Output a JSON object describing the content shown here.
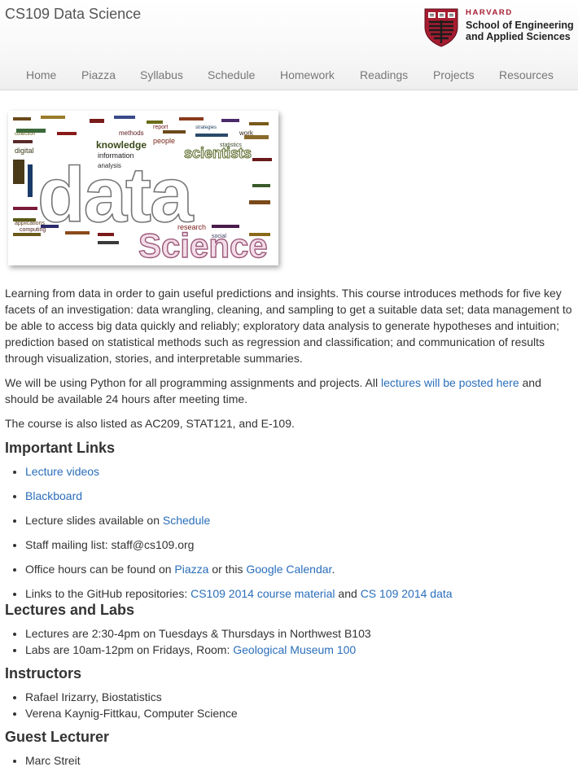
{
  "header": {
    "site_title": "CS109 Data Science",
    "logo": {
      "harvard": "HARVARD",
      "school_line1": "School of Engineering",
      "school_line2": "and Applied Sciences"
    },
    "nav": [
      "Home",
      "Piazza",
      "Syllabus",
      "Schedule",
      "Homework",
      "Readings",
      "Projects",
      "Resources"
    ]
  },
  "hero_image": {
    "title_word1": "data",
    "title_word2": "Science",
    "cloud_words": [
      "knowledge",
      "scientists",
      "information",
      "people",
      "research",
      "methods",
      "digital",
      "report",
      "work",
      "analysis",
      "computing",
      "applications",
      "collection",
      "statistics",
      "strategies",
      "social"
    ]
  },
  "intro": {
    "p1": "Learning from data in order to gain useful predictions and insights. This course introduces methods for five key facets of an investigation: data wrangling, cleaning, and sampling to get a suitable data set; data management to be able to access big data quickly and reliably; exploratory data analysis to generate hypotheses and intuition; prediction based on statistical methods such as regression and classification; and communication of results through visualization, stories, and interpretable summaries.",
    "p2_before": "We will be using Python for all programming assignments and projects. All ",
    "p2_link": "lectures will be posted here",
    "p2_after": " and should be available 24 hours after meeting time.",
    "p3": "The course is also listed as AC209, STAT121, and E-109."
  },
  "important_links": {
    "heading": "Important Links",
    "lecture_videos": "Lecture videos",
    "blackboard": "Blackboard",
    "slides_text": "Lecture slides available on ",
    "slides_link": "Schedule",
    "mailing": "Staff mailing list: staff@cs109.org",
    "office_text": "Office hours can be found on ",
    "office_link1": "Piazza",
    "office_mid": " or this ",
    "office_link2": "Google Calendar",
    "office_end": ".",
    "github_text": "Links to the GitHub repositories: ",
    "github_link1": "CS109 2014 course material",
    "github_mid": " and ",
    "github_link2": "CS 109 2014 data"
  },
  "lectures_labs": {
    "heading": "Lectures and Labs",
    "lectures": "Lectures are 2:30-4pm on Tuesdays & Thursdays in Northwest B103",
    "labs_text": "Labs are 10am-12pm on Fridays, Room: ",
    "labs_link": "Geological Museum 100"
  },
  "instructors": {
    "heading": "Instructors",
    "items": [
      "Rafael Irizarry, Biostatistics",
      "Verena Kaynig-Fittkau, Computer Science"
    ]
  },
  "guest": {
    "heading": "Guest Lecturer",
    "items": [
      "Marc Streit"
    ]
  },
  "colors": {
    "link": "#2a6ebb",
    "text": "#333333",
    "nav": "#777777",
    "harvard_crimson": "#a51c30"
  }
}
